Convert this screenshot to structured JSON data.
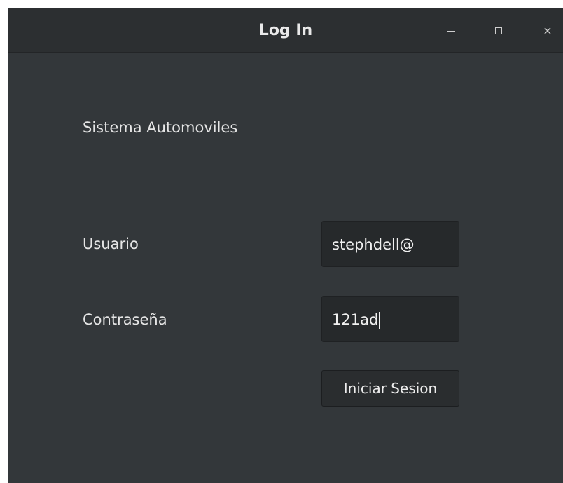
{
  "window": {
    "title": "Log In",
    "controls": {
      "minimize_icon": "minimize-icon",
      "maximize_icon": "maximize-icon",
      "close_icon": "close-icon",
      "close_glyph": "×"
    }
  },
  "form": {
    "app_title": "Sistema Automoviles",
    "username_label": "Usuario",
    "username_value": "stephdell@",
    "password_label": "Contraseña",
    "password_value": "121ad",
    "submit_label": "Iniciar Sesion"
  },
  "colors": {
    "window_bg": "#33373a",
    "titlebar_bg": "#2c2f31",
    "field_bg": "#26292b",
    "text": "#e6e6e6"
  }
}
